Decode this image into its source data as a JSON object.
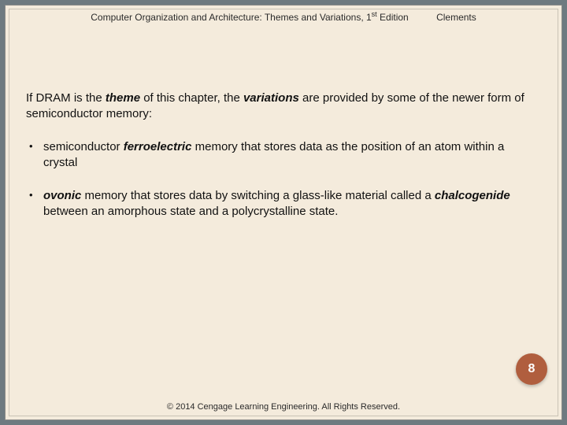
{
  "header": {
    "title_prefix": "Computer Organization and Architecture: Themes and Variations, 1",
    "title_super": "st",
    "title_suffix": " Edition",
    "author": "Clements"
  },
  "body": {
    "intro_1": "If DRAM is the ",
    "intro_bold1": "theme",
    "intro_2": " of this chapter, the ",
    "intro_bold2": "variations",
    "intro_3": " are provided by some of the newer form of semiconductor memory:",
    "bullets": [
      {
        "p1": "semiconductor ",
        "b1": "ferroelectric",
        "p2": " memory that stores data as the position of an atom within a crystal"
      },
      {
        "b1": "ovonic",
        "p2": " memory that stores data by switching a glass-like material called a ",
        "b2": "chalcogenide",
        "p3": " between an amorphous state and a polycrystalline state."
      }
    ]
  },
  "page_number": "8",
  "copyright": "© 2014 Cengage Learning Engineering. All Rights Reserved."
}
